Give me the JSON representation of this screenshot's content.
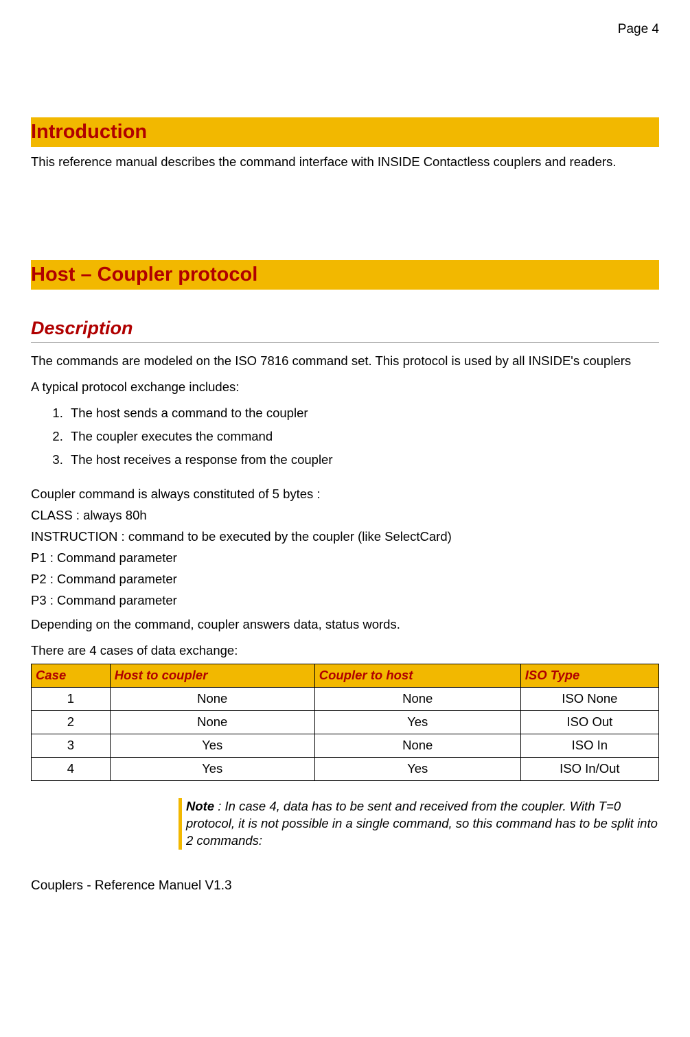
{
  "page_number": "Page 4",
  "section1": {
    "title": "Introduction",
    "text": "This reference manual describes the command interface with INSIDE Contactless couplers and readers."
  },
  "section2": {
    "title": "Host – Coupler protocol",
    "subtitle": "Description",
    "p1": "The commands are modeled on the ISO 7816 command set. This protocol is used by all INSIDE's couplers",
    "p2": "A typical protocol exchange includes:",
    "steps": [
      "The host sends a command to the coupler",
      "The coupler executes the command",
      "The host receives a response from the coupler"
    ],
    "lines": [
      "Coupler command is always constituted of 5 bytes :",
      "CLASS : always 80h",
      "INSTRUCTION : command to be executed by the coupler (like SelectCard)",
      "P1 : Command parameter",
      "P2 : Command parameter",
      "P3 : Command parameter"
    ],
    "p3": "Depending on the command, coupler answers data, status words.",
    "p4": "There are 4 cases of data exchange:",
    "table": {
      "headers": [
        "Case",
        "Host to coupler",
        "Coupler to host",
        "ISO Type"
      ],
      "rows": [
        [
          "1",
          "None",
          "None",
          "ISO None"
        ],
        [
          "2",
          "None",
          "Yes",
          "ISO Out"
        ],
        [
          "3",
          "Yes",
          "None",
          "ISO In"
        ],
        [
          "4",
          "Yes",
          "Yes",
          "ISO In/Out"
        ]
      ]
    },
    "note_label": "Note",
    "note_text": " : In case 4, data has to be sent and received from the coupler. With T=0 protocol, it is not possible in a single command, so this command has to be split into 2 commands:"
  },
  "footer": "Couplers - Reference Manuel V1.3"
}
